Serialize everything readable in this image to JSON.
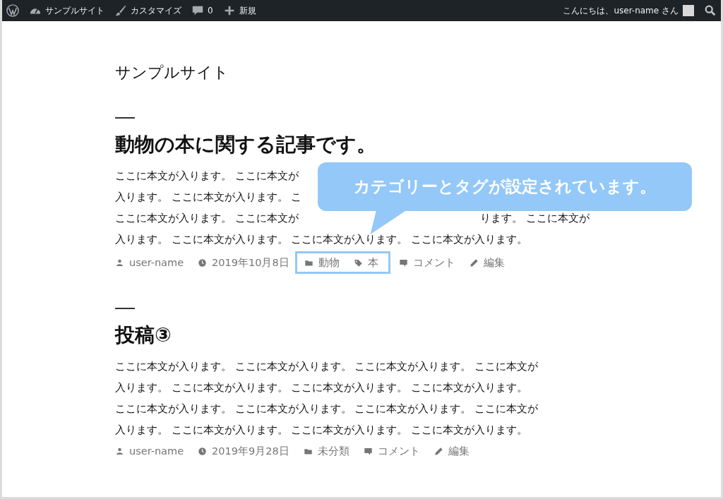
{
  "admin_bar": {
    "left": [
      {
        "kind": "logo"
      },
      {
        "kind": "site",
        "label": "サンプルサイト"
      },
      {
        "kind": "customize",
        "label": "カスタマイズ"
      },
      {
        "kind": "comments",
        "label": "0"
      },
      {
        "kind": "new",
        "label": "新規"
      }
    ],
    "greeting": "こんにちは、user-name さん"
  },
  "site_title": "サンプルサイト",
  "posts": [
    {
      "title": "動物の本に関する記事です。",
      "body_lines": [
        [
          "ここに本文が入ります。 ここに本文が"
        ],
        [
          "入ります。 ここに本文が入ります。 こ"
        ],
        [
          "ここに本文が入ります。 ここに本文が",
          "ります。 ここに本文が"
        ],
        [
          "入ります。 ここに本文が入ります。 ここに本文が入ります。 ここに本文が入ります。"
        ]
      ],
      "meta": [
        {
          "kind": "author",
          "label": "user-name",
          "highlighted": false
        },
        {
          "kind": "date",
          "label": "2019年10月8日",
          "highlighted": false
        },
        {
          "kind": "category",
          "label": "動物",
          "highlighted": true
        },
        {
          "kind": "tag",
          "label": "本",
          "highlighted": true
        },
        {
          "kind": "comments",
          "label": "コメント",
          "highlighted": false
        },
        {
          "kind": "edit",
          "label": "編集",
          "highlighted": false
        }
      ]
    },
    {
      "title": "投稿③",
      "body_lines": [
        [
          "ここに本文が入ります。 ここに本文が入ります。 ここに本文が入ります。 ここに本文が"
        ],
        [
          "入ります。 ここに本文が入ります。 ここに本文が入ります。 ここに本文が入ります。"
        ],
        [
          "ここに本文が入ります。 ここに本文が入ります。 ここに本文が入ります。 ここに本文が"
        ],
        [
          "入ります。 ここに本文が入ります。 ここに本文が入ります。 ここに本文が入ります。"
        ]
      ],
      "meta": [
        {
          "kind": "author",
          "label": "user-name",
          "highlighted": false
        },
        {
          "kind": "date",
          "label": "2019年9月28日",
          "highlighted": false
        },
        {
          "kind": "category",
          "label": "未分類",
          "highlighted": false
        },
        {
          "kind": "comments",
          "label": "コメント",
          "highlighted": false
        },
        {
          "kind": "edit",
          "label": "編集",
          "highlighted": false
        }
      ]
    }
  ],
  "callout": {
    "text": "カテゴリーとタグが設定されています。"
  }
}
